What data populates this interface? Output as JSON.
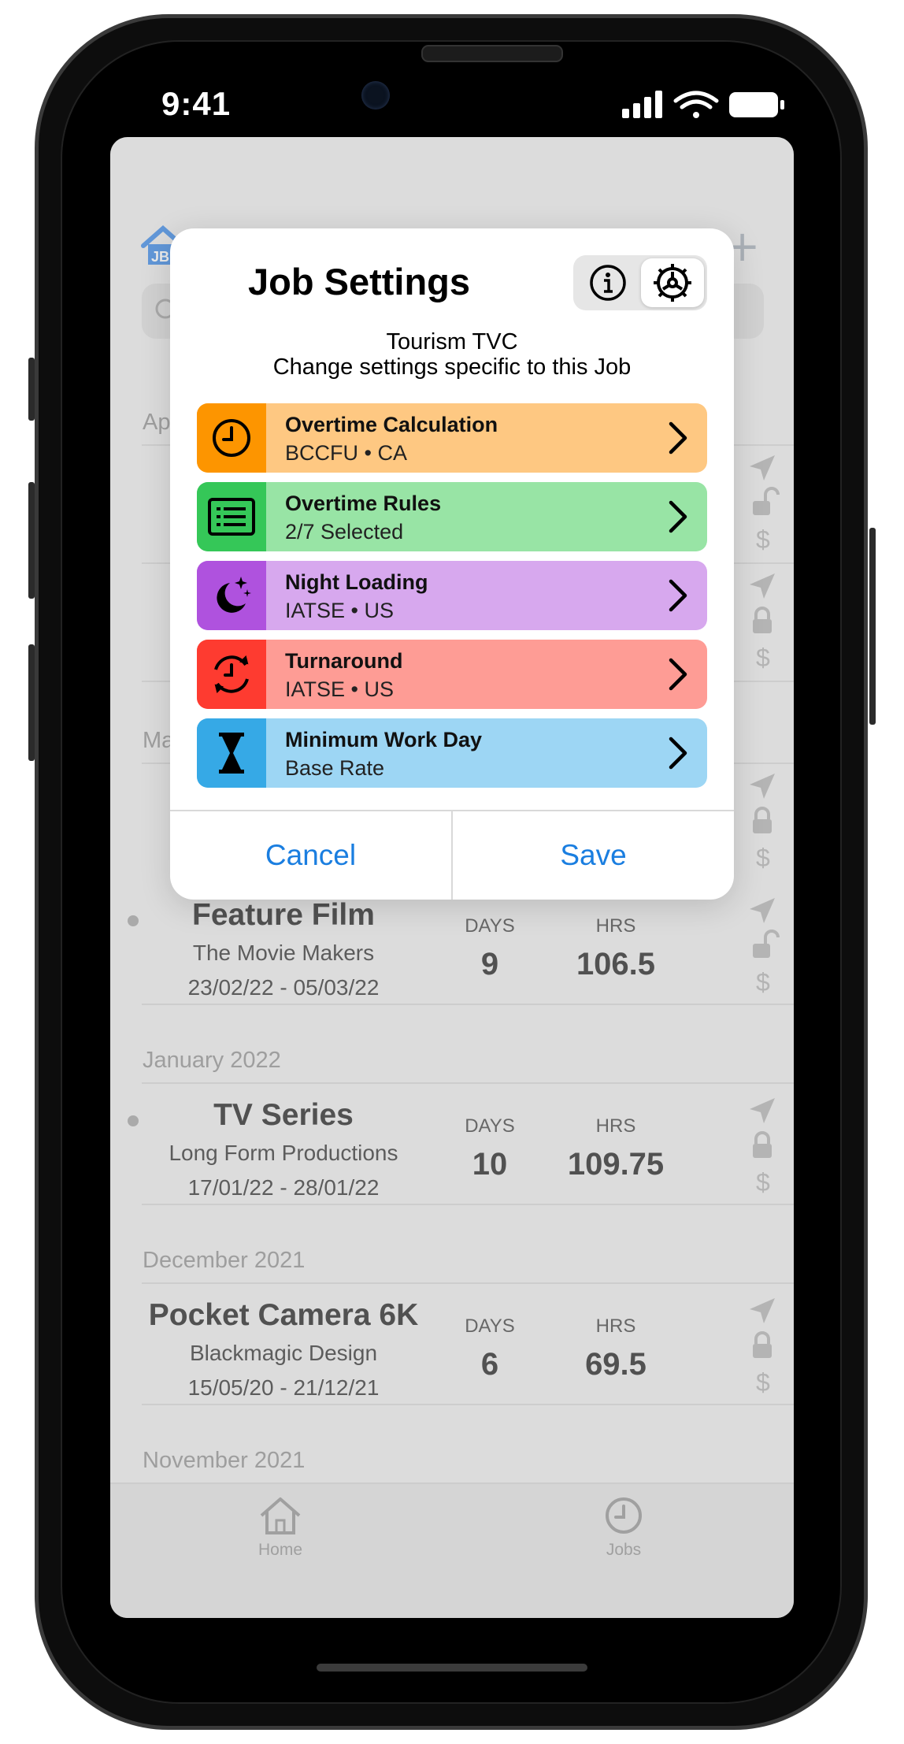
{
  "status_bar": {
    "time": "9:41"
  },
  "header": {
    "logo_text": "JB",
    "add_symbol": "+"
  },
  "sections": [
    {
      "label": "Ap"
    },
    {
      "label": "Ma"
    },
    {
      "label": "January 2022"
    },
    {
      "label": "December 2021"
    },
    {
      "label": "November 2021"
    }
  ],
  "jobs": [
    {
      "title": "Feature Film",
      "client": "The Movie Makers",
      "dates": "23/02/22 - 05/03/22",
      "days_label": "DAYS",
      "days": "9",
      "hrs_label": "HRS",
      "hrs": "106.5",
      "lock": "unlocked",
      "dot": true
    },
    {
      "title": "TV Series",
      "client": "Long Form Productions",
      "dates": "17/01/22 - 28/01/22",
      "days_label": "DAYS",
      "days": "10",
      "hrs_label": "HRS",
      "hrs": "109.75",
      "lock": "locked",
      "dot": true
    },
    {
      "title": "Pocket Camera 6K",
      "client": "Blackmagic Design",
      "dates": "15/05/20 - 21/12/21",
      "days_label": "DAYS",
      "days": "6",
      "hrs_label": "HRS",
      "hrs": "69.5",
      "lock": "locked",
      "dot": false
    }
  ],
  "tabs": [
    {
      "label": "Home",
      "icon": "house-icon"
    },
    {
      "label": "Jobs",
      "icon": "clock-icon"
    }
  ],
  "modal": {
    "title": "Job Settings",
    "job_name": "Tourism TVC",
    "subtitle": "Change settings specific to this Job",
    "segments": [
      {
        "icon": "info-icon"
      },
      {
        "icon": "gear-icon",
        "active": true
      }
    ],
    "options": [
      {
        "name": "Overtime Calculation",
        "value": "BCCFU • CA",
        "icon": "clock-icon",
        "color": "#fec882",
        "icon_bg": "#fd9500"
      },
      {
        "name": "Overtime Rules",
        "value": "2/7 Selected",
        "icon": "list-icon",
        "color": "#98e4a5",
        "icon_bg": "#35c758"
      },
      {
        "name": "Night Loading",
        "value": "IATSE • US",
        "icon": "moon-stars-icon",
        "color": "#d7a8ee",
        "icon_bg": "#af52de"
      },
      {
        "name": "Turnaround",
        "value": "IATSE • US",
        "icon": "clock-cycle-icon",
        "color": "#fe9c95",
        "icon_bg": "#fe3b30"
      },
      {
        "name": "Minimum Work Day",
        "value": "Base Rate",
        "icon": "hourglass-icon",
        "color": "#9dd6f4",
        "icon_bg": "#36a9e6"
      }
    ],
    "cancel_label": "Cancel",
    "save_label": "Save"
  }
}
